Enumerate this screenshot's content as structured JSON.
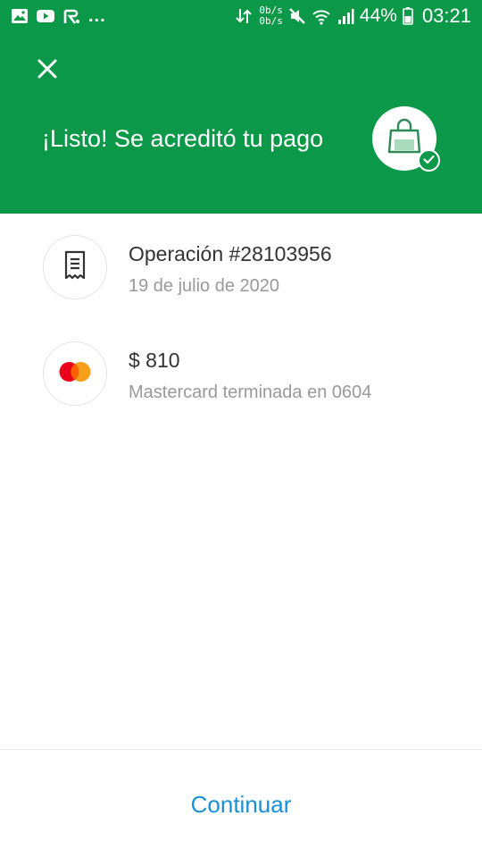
{
  "status_bar": {
    "overflow_dots": "...",
    "net_up": "0b/s",
    "net_down": "0b/s",
    "battery_pct": "44%",
    "time": "03:21",
    "icons": [
      "gallery-icon",
      "youtube-icon",
      "accessibility-icon",
      "data-arrows-icon",
      "mute-icon",
      "wifi-icon",
      "signal-icon",
      "battery-icon"
    ]
  },
  "header": {
    "title": "¡Listo! Se acreditó tu pago",
    "close_icon": "close-icon",
    "badge_icon": "shopping-bag-icon",
    "check_icon": "check-icon"
  },
  "operation": {
    "title": "Operación #28103956",
    "date": "19 de julio de 2020",
    "icon": "receipt-icon"
  },
  "payment": {
    "amount": "$ 810",
    "method": "Mastercard terminada en 0604",
    "icon": "mastercard-icon"
  },
  "footer": {
    "continue_label": "Continuar"
  },
  "colors": {
    "brand_green": "#0b9848",
    "link_blue": "#1a90d8",
    "mastercard_red": "#eb001b",
    "mastercard_orange": "#f79e1b"
  }
}
